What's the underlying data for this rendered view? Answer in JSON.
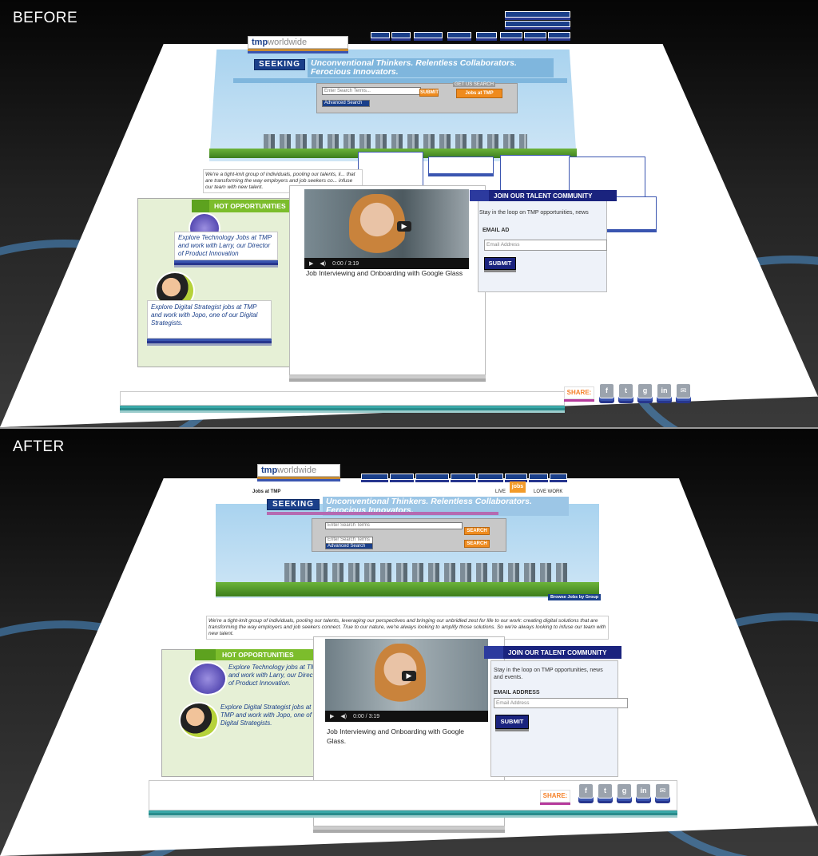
{
  "before": {
    "label": "BEFORE",
    "logo": {
      "brand": "tmp",
      "suffix": "worldwide"
    },
    "seeking": "SEEKING",
    "tagline": "Unconventional Thinkers. Relentless Collaborators. Ferocious Innovators.",
    "search": {
      "placeholder": "Enter Search Terms...",
      "submit": "SUBMIT",
      "advanced": "Advanced Search",
      "jobs_at": "Jobs at TMP",
      "get_us": "GET US SEARCH"
    },
    "intro": "We're a tight-knit group of individuals, pooling our talents, li... that are transforming the way employers and job seekers co... infuse our team with new talent.",
    "hot": {
      "title": "HOT OPPORTUNITIES",
      "items": [
        "Explore Technology Jobs at TMP and work with Larry, our Director of Product Innovation",
        "Explore Digital Strategist jobs at TMP and work with Jopo, one of our Digital Strategists."
      ]
    },
    "video": {
      "time": "0:00 / 3:19",
      "caption": "Job Interviewing and Onboarding with Google Glass"
    },
    "talent": {
      "title": "JOIN OUR TALENT COMMUNITY",
      "text": "Stay in the loop on TMP opportunities, news",
      "email_label": "EMAIL AD",
      "email_placeholder": "Email Address",
      "submit": "SUBMIT"
    },
    "share": "SHARE:"
  },
  "after": {
    "label": "AFTER",
    "logo": {
      "brand": "tmp",
      "suffix": "worldwide"
    },
    "jobs_at": "Jobs at TMP",
    "seeking": "SEEKING",
    "tagline": "Unconventional Thinkers. Relentless Collaborators. Ferocious Innovators.",
    "search": {
      "placeholder": "Enter Search Terms",
      "search_btn": "SEARCH",
      "advanced": "Advanced Search"
    },
    "live_love": {
      "live": "LIVE",
      "love": "LOVE WORK",
      "jobs": "jobs"
    },
    "browse": "Browse Jobs by Group",
    "intro": "We're a tight-knit group of individuals, pooling our talents, leveraging our perspectives and bringing our unbridled zest for life to our work: creating digital solutions that are transforming the way employers and job seekers connect. True to our nature, we're always looking to amplify those solutions. So we're always looking to infuse our team with new talent.",
    "hot": {
      "title": "HOT OPPORTUNITIES",
      "items": [
        "Explore Technology jobs at TMP and work with Larry, our Director of Product Innovation.",
        "Explore Digital Strategist jobs at TMP and work with Jopo, one of our Digital Strategists."
      ]
    },
    "video": {
      "time": "0:00 / 3:19",
      "caption": "Job Interviewing and Onboarding with Google Glass."
    },
    "talent": {
      "title": "JOIN OUR TALENT COMMUNITY",
      "text": "Stay in the loop on TMP opportunities, news and events.",
      "email_label": "EMAIL ADDRESS",
      "email_placeholder": "Email Address",
      "submit": "SUBMIT"
    },
    "share": "SHARE:"
  },
  "social_icons": [
    "facebook-icon",
    "twitter-icon",
    "google-plus-icon",
    "linkedin-icon",
    "email-icon"
  ],
  "social_glyphs": [
    "f",
    "t",
    "g",
    "in",
    "✉"
  ],
  "colors": {
    "brand_navy": "#1a237e",
    "accent_green": "#7cbd2c",
    "accent_orange": "#ef8b1e",
    "sky": "#a9d3ef"
  }
}
